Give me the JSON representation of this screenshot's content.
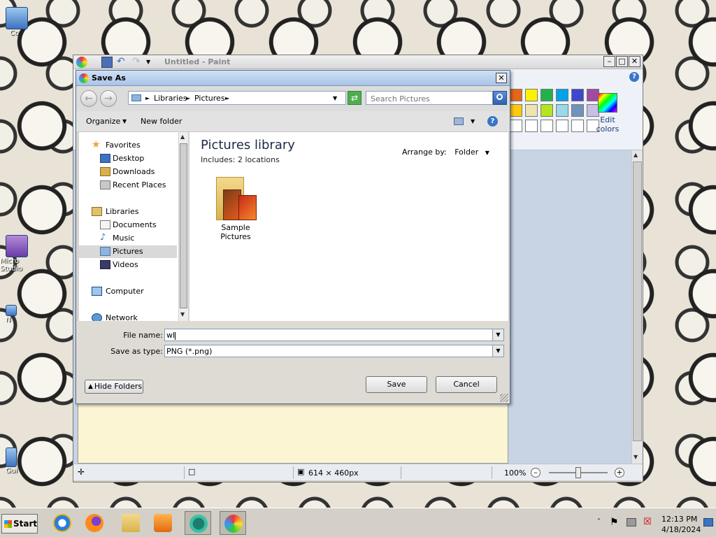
{
  "desktop": {
    "icons": [
      {
        "label": "Co"
      },
      {
        "label": "Micro Studio"
      },
      {
        "label": "N"
      },
      {
        "label": "Gui"
      }
    ]
  },
  "paint": {
    "title": "Untitled - Paint",
    "edit_colors_label": "Edit colors",
    "palette_colors": [
      "#e8661a",
      "#fff200",
      "#22b14c",
      "#00a2e8",
      "#3f48cc",
      "#a349a4",
      "#ffc90e",
      "#efe4b0",
      "#b5e61d",
      "#99d9ea",
      "#7092be",
      "#c8bfe7"
    ],
    "status": {
      "dimensions": "614 × 460px",
      "zoom": "100%",
      "zoom_fraction": 0.5
    }
  },
  "dialog": {
    "title": "Save As",
    "breadcrumb": [
      "Libraries",
      "Pictures"
    ],
    "search_placeholder": "Search Pictures",
    "toolbar": {
      "organize": "Organize",
      "new_folder": "New folder"
    },
    "nav": {
      "favorites": "Favorites",
      "desktop": "Desktop",
      "downloads": "Downloads",
      "recent_places": "Recent Places",
      "libraries": "Libraries",
      "documents": "Documents",
      "music": "Music",
      "pictures": "Pictures",
      "videos": "Videos",
      "computer": "Computer",
      "network": "Network"
    },
    "library_title": "Pictures library",
    "includes": "Includes:  2 locations",
    "arrange_by_label": "Arrange by:",
    "arrange_by_value": "Folder",
    "folder_name": "Sample Pictures",
    "file_name_label": "File name:",
    "file_name_value": "wl",
    "save_type_label": "Save as type:",
    "save_type_value": "PNG (*.png)",
    "hide_folders": "Hide Folders",
    "save": "Save",
    "cancel": "Cancel"
  },
  "taskbar": {
    "start": "Start",
    "time": "12:13 PM",
    "date": "4/18/2024"
  }
}
